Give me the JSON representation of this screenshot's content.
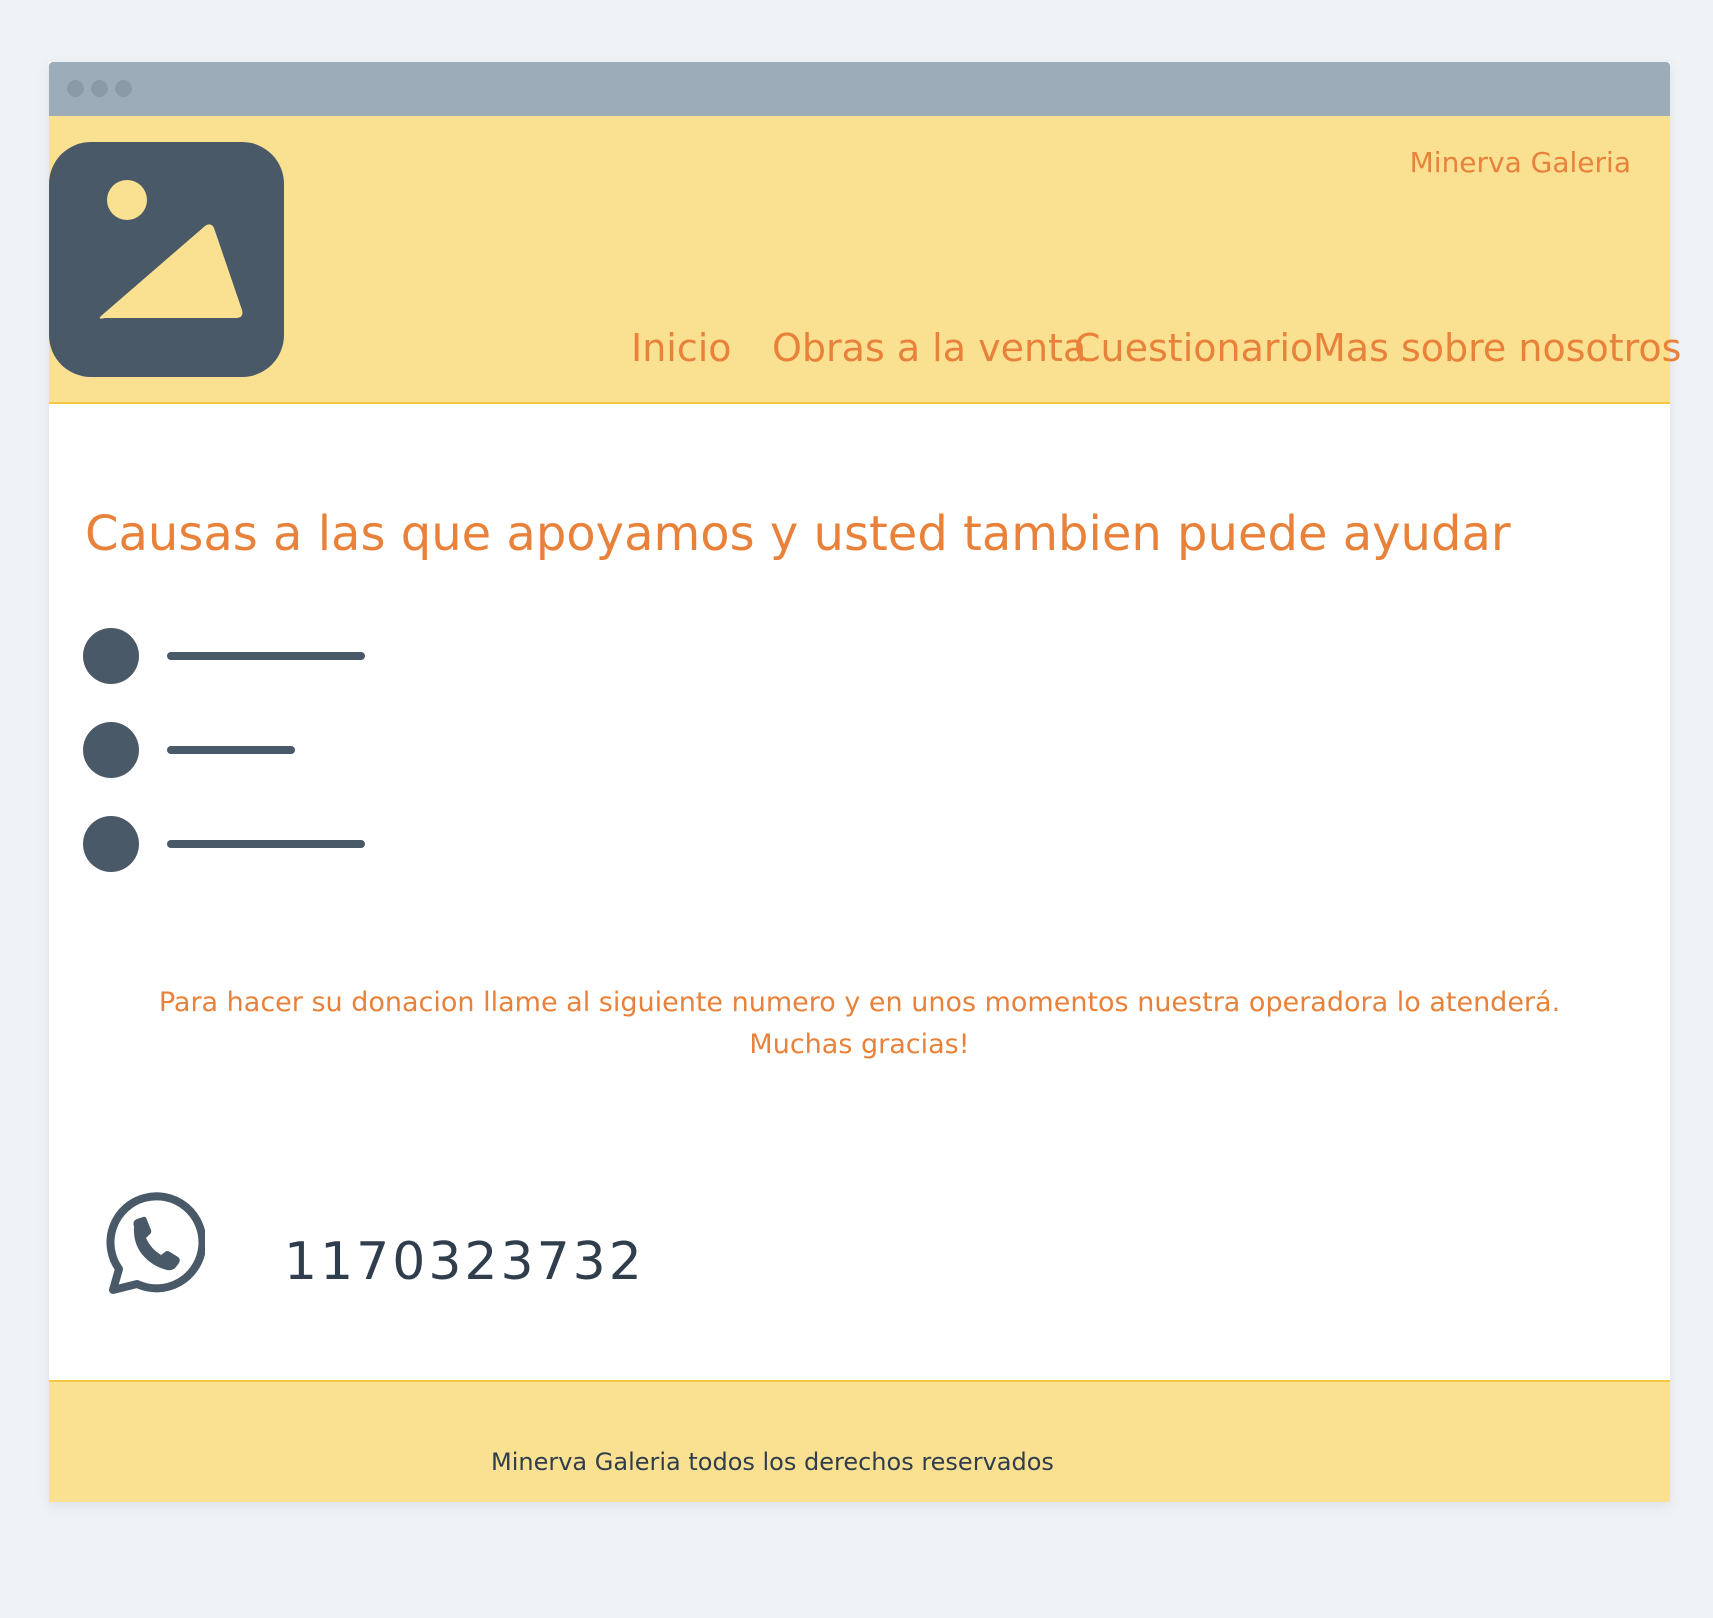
{
  "window": {
    "titlebar_dots": 3
  },
  "header": {
    "brand": "Minerva Galeria",
    "logo_icon": "image-placeholder-icon",
    "nav": [
      {
        "label": "Inicio"
      },
      {
        "label": "Obras a la venta"
      },
      {
        "label": "Cuestionario"
      },
      {
        "label": "Mas sobre nosotros"
      }
    ]
  },
  "main": {
    "heading": "Causas a las que apoyamos y usted tambien puede ayudar",
    "bullet_list_count": 3,
    "info_line1": "Para hacer su donacion  llame al siguiente numero y en unos momentos nuestra operadora lo atenderá.",
    "info_line2": "Muchas gracias!",
    "contact_icon": "whatsapp-icon",
    "phone": "1170323732"
  },
  "footer": {
    "text": "Minerva Galeria todos los derechos reservados"
  },
  "colors": {
    "header_bg": "#fae192",
    "header_border": "#f5c745",
    "accent_text": "#e8823a",
    "dark": "#4a5968",
    "titlebar": "#9cadb9",
    "page_bg": "#eff3f6"
  }
}
